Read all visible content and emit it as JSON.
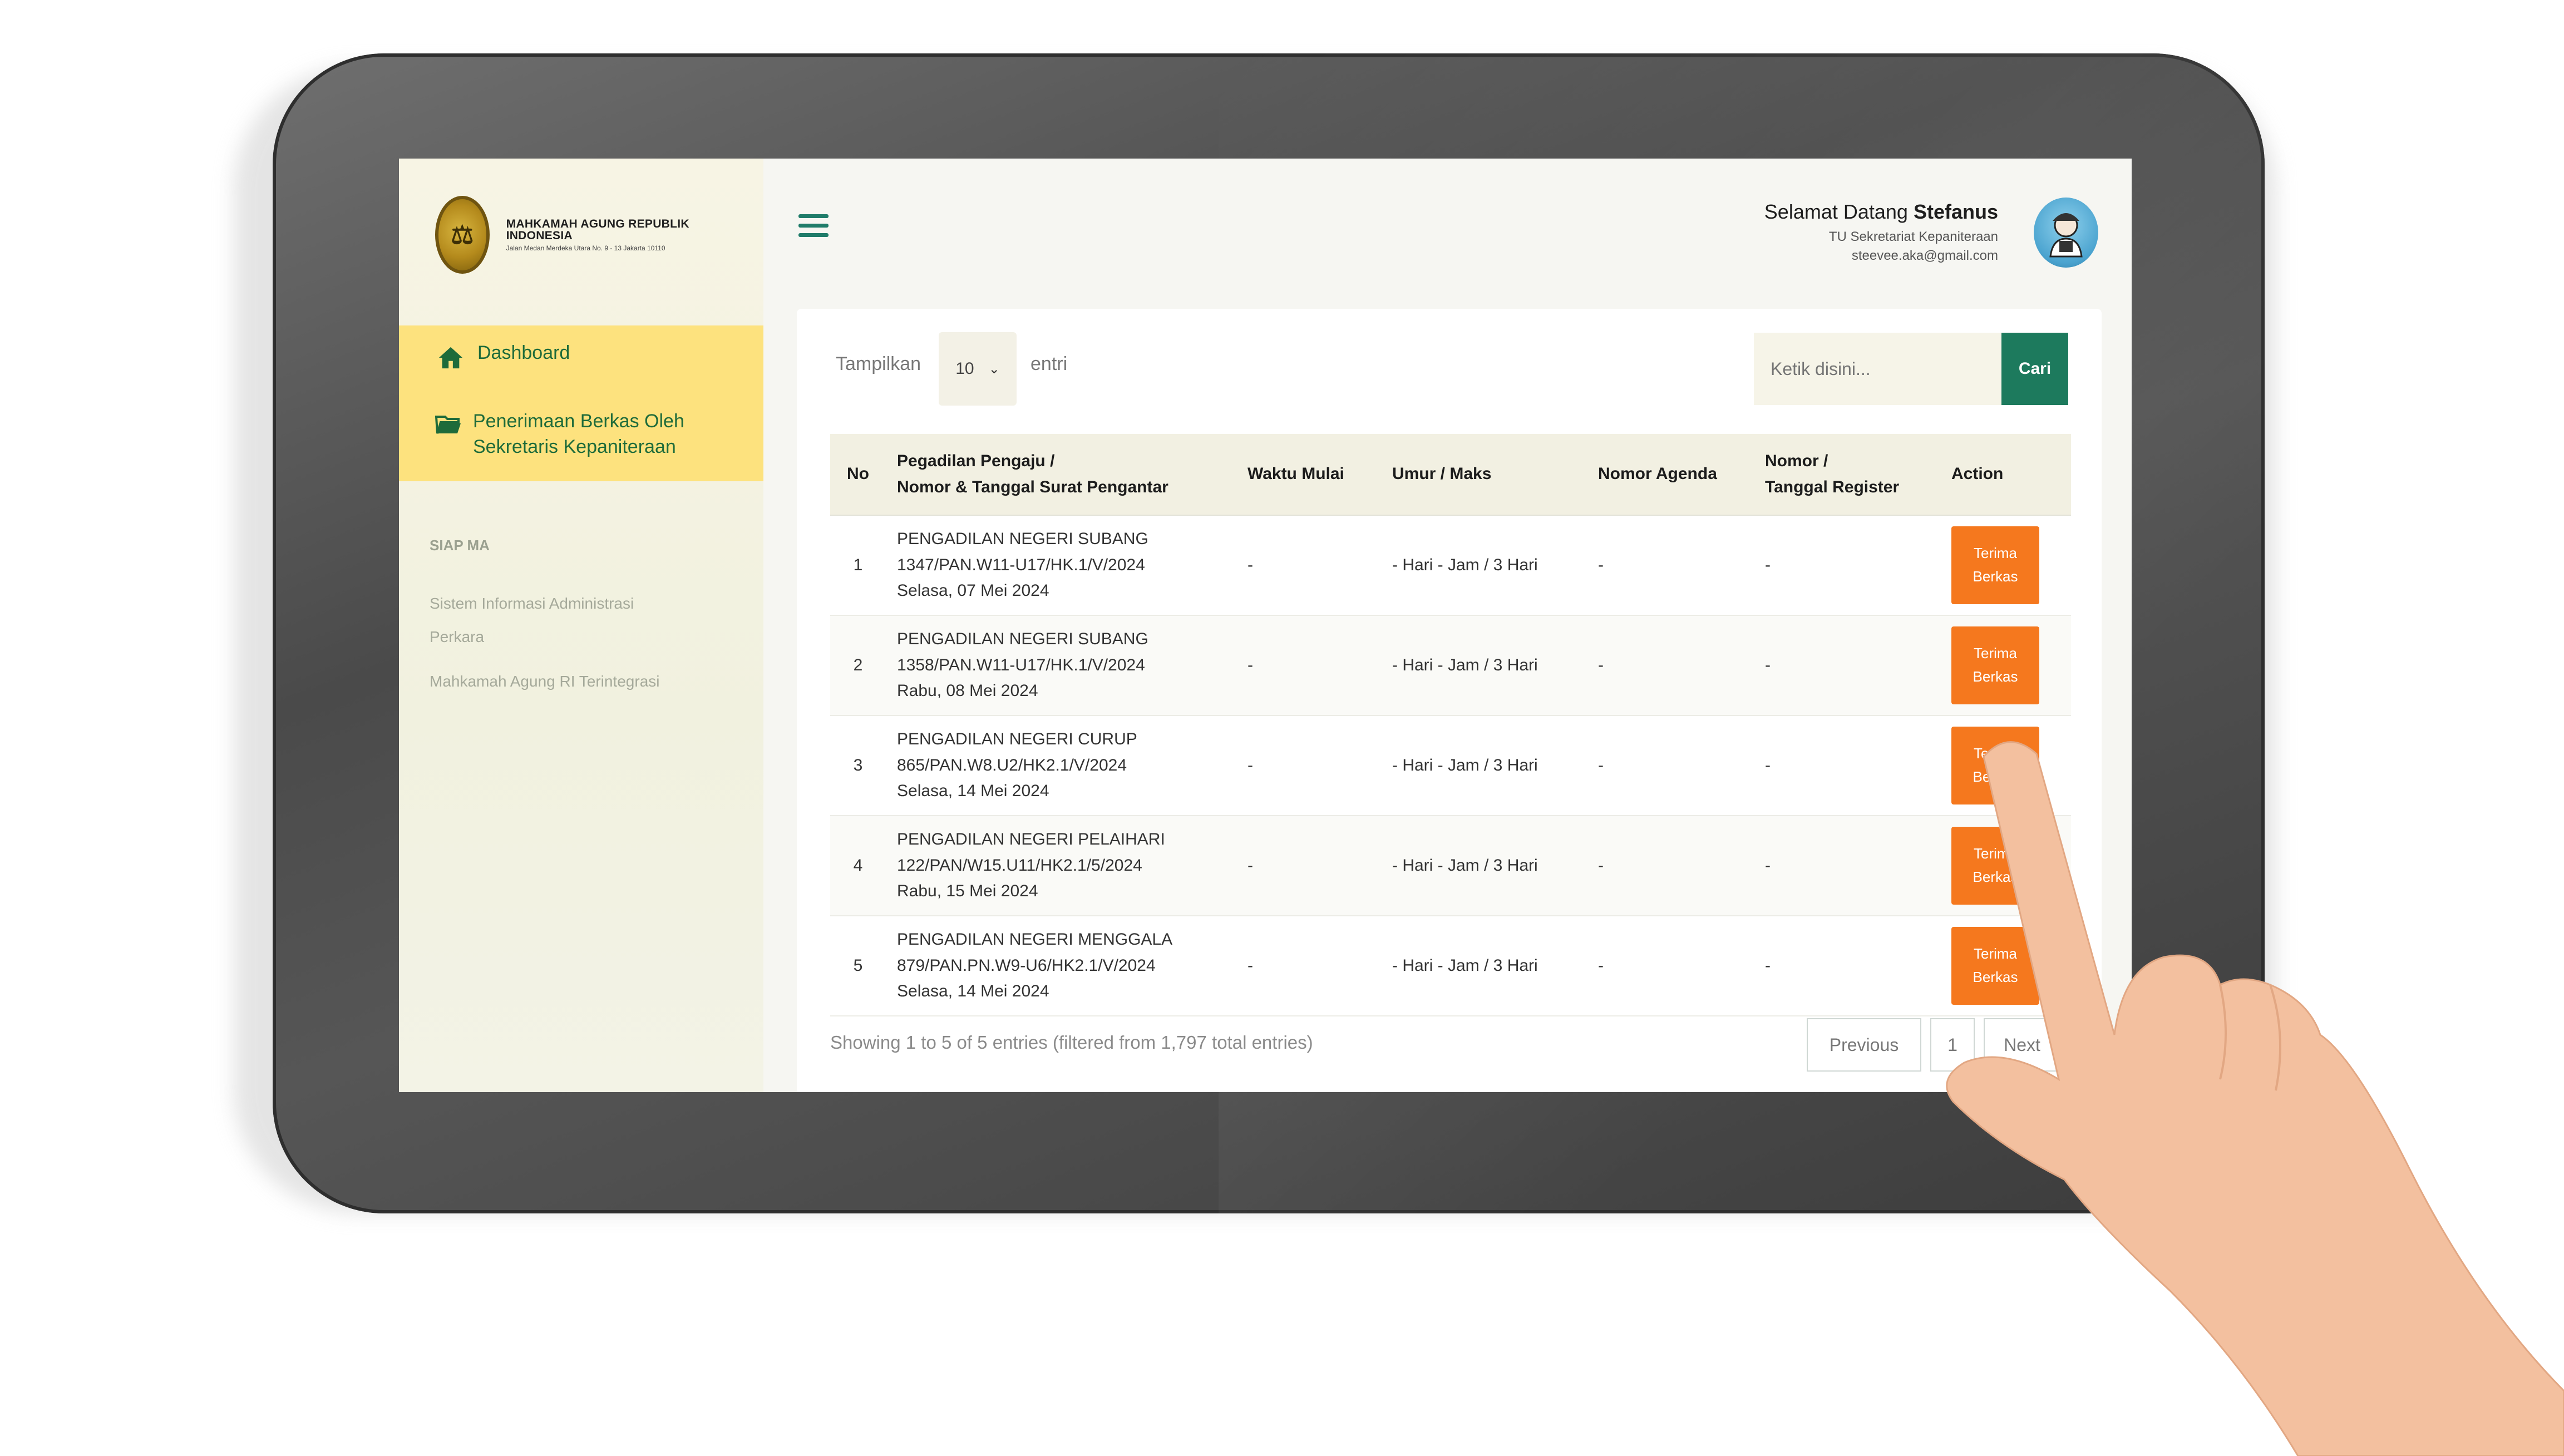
{
  "brand": {
    "title": "MAHKAMAH AGUNG REPUBLIK INDONESIA",
    "subtitle": "Jalan Medan Merdeka Utara No. 9 - 13 Jakarta 10110"
  },
  "sidebar": {
    "items": [
      {
        "label": "Dashboard",
        "icon": "home-icon"
      },
      {
        "label": "Penerimaan Berkas Oleh Sekretaris Kepaniteraan",
        "icon": "folder-open-icon"
      }
    ],
    "section_label": "SIAP MA",
    "links": [
      {
        "label": "Sistem Informasi Administrasi Perkara"
      },
      {
        "label": "Mahkamah Agung RI Terintegrasi"
      }
    ]
  },
  "header": {
    "welcome_prefix": "Selamat Datang",
    "user_name": "Stefanus",
    "user_role": "TU Sekretariat Kepaniteraan",
    "user_email": "steevee.aka@gmail.com"
  },
  "controls": {
    "show_label": "Tampilkan",
    "page_size": "10",
    "entries_label": "entri",
    "search_placeholder": "Ketik disini...",
    "search_button": "Cari"
  },
  "table": {
    "headers": {
      "no": "No",
      "pengadilan_line1": "Pegadilan Pengaju /",
      "pengadilan_line2": "Nomor & Tanggal Surat Pengantar",
      "waktu": "Waktu Mulai",
      "umur": "Umur / Maks",
      "agenda": "Nomor Agenda",
      "register_line1": "Nomor /",
      "register_line2": "Tanggal Register",
      "action": "Action"
    },
    "rows": [
      {
        "no": "1",
        "court": "PENGADILAN NEGERI SUBANG",
        "letter": "1347/PAN.W11-U17/HK.1/V/2024",
        "date": "Selasa, 07 Mei 2024",
        "waktu": "-",
        "umur": "- Hari - Jam / 3 Hari",
        "agenda": "-",
        "register": "-",
        "action": "Terima Berkas"
      },
      {
        "no": "2",
        "court": "PENGADILAN NEGERI SUBANG",
        "letter": "1358/PAN.W11-U17/HK.1/V/2024",
        "date": "Rabu, 08 Mei 2024",
        "waktu": "-",
        "umur": "- Hari - Jam / 3 Hari",
        "agenda": "-",
        "register": "-",
        "action": "Terima Berkas"
      },
      {
        "no": "3",
        "court": "PENGADILAN NEGERI CURUP",
        "letter": "865/PAN.W8.U2/HK2.1/V/2024",
        "date": "Selasa, 14 Mei 2024",
        "waktu": "-",
        "umur": "- Hari - Jam / 3 Hari",
        "agenda": "-",
        "register": "-",
        "action": "Terima Berkas"
      },
      {
        "no": "4",
        "court": "PENGADILAN NEGERI PELAIHARI",
        "letter": "122/PAN/W15.U11/HK2.1/5/2024",
        "date": "Rabu, 15 Mei 2024",
        "waktu": "-",
        "umur": "- Hari - Jam / 3 Hari",
        "agenda": "-",
        "register": "-",
        "action": "Terima Berkas"
      },
      {
        "no": "5",
        "court": "PENGADILAN NEGERI MENGGALA",
        "letter": "879/PAN.PN.W9-U6/HK2.1/V/2024",
        "date": "Selasa, 14 Mei 2024",
        "waktu": "-",
        "umur": "- Hari - Jam / 3 Hari",
        "agenda": "-",
        "register": "-",
        "action": "Terima Berkas"
      }
    ]
  },
  "footer": {
    "info": "Showing 1 to 5 of 5 entries (filtered from 1,797 total entries)",
    "previous": "Previous",
    "page": "1",
    "next": "Next"
  },
  "colors": {
    "accent_green": "#1d7a5d",
    "nav_active": "#fde27e",
    "action_orange": "#f5781e"
  }
}
